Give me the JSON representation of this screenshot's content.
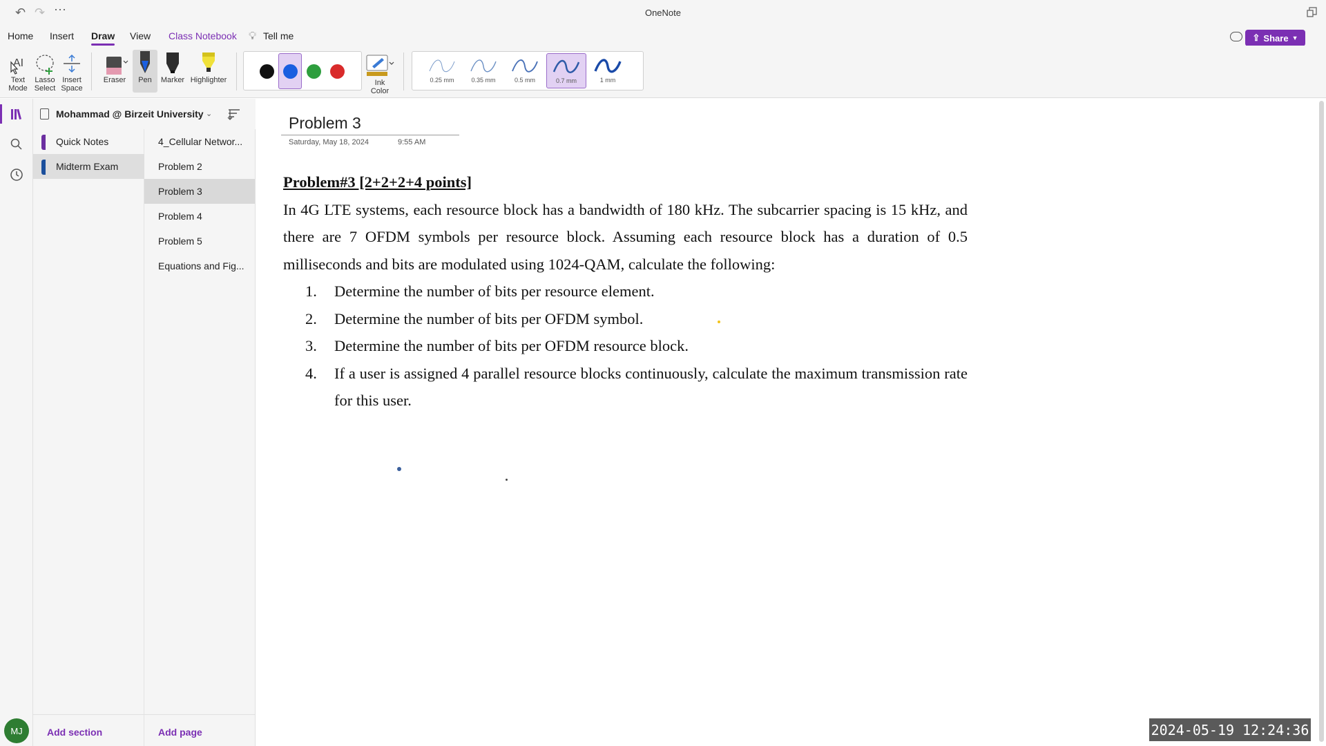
{
  "window": {
    "title": "OneNote"
  },
  "tabs": [
    {
      "label": "Home"
    },
    {
      "label": "Insert"
    },
    {
      "label": "Draw"
    },
    {
      "label": "View"
    },
    {
      "label": "Class Notebook"
    },
    {
      "label": "Tell me"
    }
  ],
  "share_label": "Share",
  "ribbon": {
    "text_mode": "Text Mode",
    "lasso_select": "Lasso Select",
    "insert_space": "Insert Space",
    "eraser": "Eraser",
    "pen": "Pen",
    "marker": "Marker",
    "highlighter": "Highlighter",
    "ink_color": "Ink Color",
    "colors": [
      "#111111",
      "#1a5fe0",
      "#2e9e3e",
      "#d92b2b"
    ],
    "selected_color": "#1a5fe0",
    "widths": [
      "0.25 mm",
      "0.35 mm",
      "0.5 mm",
      "0.7 mm",
      "1 mm"
    ],
    "selected_width": "0.7 mm"
  },
  "notebook": {
    "name": "Mohammad @ Birzeit University"
  },
  "sections": [
    {
      "label": "Quick Notes",
      "color": "#6b2fa0"
    },
    {
      "label": "Midterm Exam",
      "color": "#1b4f9c"
    }
  ],
  "pages": [
    {
      "label": "4_Cellular Networ..."
    },
    {
      "label": "Problem 2"
    },
    {
      "label": "Problem 3"
    },
    {
      "label": "Problem 4"
    },
    {
      "label": "Problem 5"
    },
    {
      "label": "Equations and Fig..."
    }
  ],
  "add_section": "Add section",
  "add_page": "Add page",
  "avatar": "MJ",
  "note": {
    "title": "Problem 3",
    "date": "Saturday, May 18, 2024",
    "time": "9:55 AM",
    "heading": "Problem#3 [2+2+2+4 points]",
    "paragraph": "In 4G LTE systems, each resource block has a bandwidth of 180 kHz. The subcarrier spacing is 15 kHz, and there are 7 OFDM symbols per resource block. Assuming each resource block has a duration of 0.5 milliseconds and bits are modulated using 1024-QAM, calculate the following:",
    "items": [
      {
        "num": "1.",
        "text": "Determine the number of bits per resource element."
      },
      {
        "num": "2.",
        "text": "Determine the number of bits per OFDM symbol."
      },
      {
        "num": "3.",
        "text": "Determine the number of bits per OFDM resource block."
      },
      {
        "num": "4.",
        "text": "If a user is assigned 4 parallel resource blocks continuously, calculate the maximum transmission rate for this user."
      }
    ]
  },
  "overlay_timestamp": "2024-05-19 12:24:36"
}
